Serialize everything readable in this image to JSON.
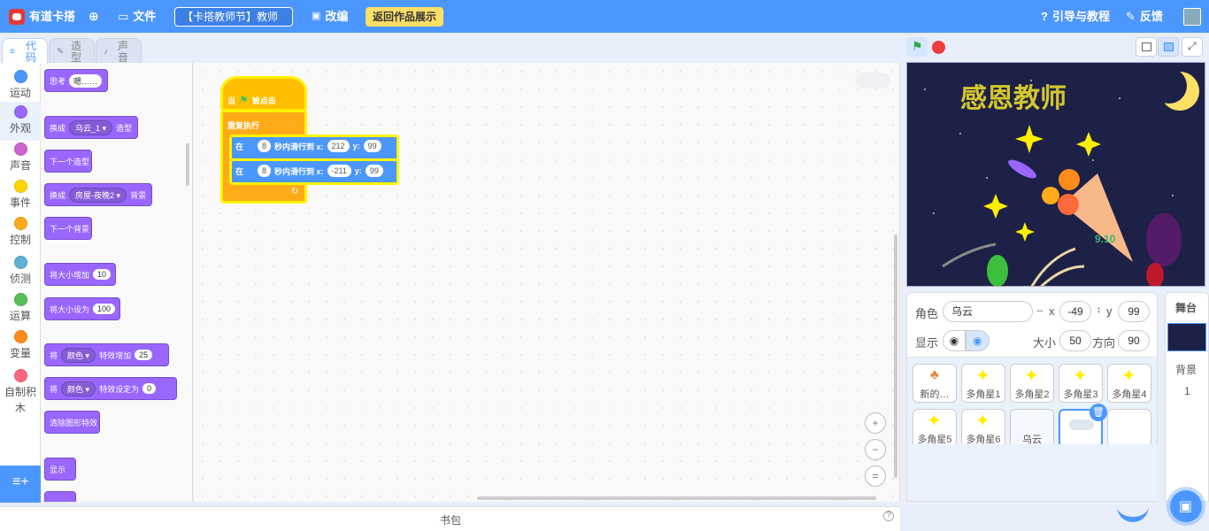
{
  "topbar": {
    "logo_text": "有道卡搭",
    "file_menu": "文件",
    "project_title": "【卡搭教师节】教师",
    "remix": "改编",
    "return_button": "返回作品展示",
    "tutorial": "引导与教程",
    "feedback": "反馈"
  },
  "tabs": {
    "code": "代码",
    "costumes": "造型",
    "sounds": "声音"
  },
  "categories": [
    {
      "label": "运动",
      "color": "#4c97ff"
    },
    {
      "label": "外观",
      "color": "#9966ff"
    },
    {
      "label": "声音",
      "color": "#cf63cf"
    },
    {
      "label": "事件",
      "color": "#ffd500"
    },
    {
      "label": "控制",
      "color": "#ffab19"
    },
    {
      "label": "侦测",
      "color": "#5cb1d6"
    },
    {
      "label": "运算",
      "color": "#59c059"
    },
    {
      "label": "变量",
      "color": "#ff8c1a"
    },
    {
      "label": "自制积木",
      "color": "#ff6680"
    }
  ],
  "palette": {
    "think": "思考",
    "think_value": "嗯……",
    "switch_costume": "换成",
    "costume_name": "乌云_1",
    "costume_suffix": "造型",
    "next_costume": "下一个造型",
    "switch_backdrop": "换成",
    "backdrop_name": "房屋-夜晚2",
    "backdrop_suffix": "背景",
    "next_backdrop": "下一个背景",
    "change_size": "将大小增加",
    "change_size_value": "10",
    "set_size": "将大小设为",
    "set_size_value": "100",
    "effect_prefix": "将",
    "effect_name": "颜色",
    "change_effect": "特效增加",
    "change_effect_value": "25",
    "set_effect": "特效设定为",
    "set_effect_value": "0",
    "clear_effects": "清除图形特效",
    "show": "显示"
  },
  "script": {
    "hat_when": "当",
    "hat_clicked": "被点击",
    "forever": "重复执行",
    "glide1": {
      "in": "在",
      "secs": "8",
      "text": "秒内滑行到 x:",
      "x": "212",
      "y_label": "y:",
      "y": "99"
    },
    "glide2": {
      "in": "在",
      "secs": "8",
      "text": "秒内滑行到 x:",
      "x": "-211",
      "y_label": "y:",
      "y": "99"
    }
  },
  "zoom": {
    "zoom_in": "+",
    "zoom_out": "−",
    "reset": "="
  },
  "backpack": "书包",
  "stage": {
    "title_text": "感恩教师",
    "date_text": "9.10"
  },
  "sprite_info": {
    "sprite_label": "角色",
    "sprite_name": "乌云",
    "x_label": "x",
    "x_value": "-49",
    "y_label": "y",
    "y_value": "99",
    "show_label": "显示",
    "size_label": "大小",
    "size_value": "50",
    "direction_label": "方向",
    "direction_value": "90"
  },
  "sprites": [
    {
      "name": "新的…"
    },
    {
      "name": "多角星1"
    },
    {
      "name": "多角星2"
    },
    {
      "name": "多角星3"
    },
    {
      "name": "多角星4"
    },
    {
      "name": "多角星5"
    },
    {
      "name": "多角星6"
    },
    {
      "name": "乌云"
    },
    {
      "name": ""
    },
    {
      "name": ""
    }
  ],
  "stage_panel": {
    "title": "舞台",
    "backdrop_label": "背景",
    "backdrop_count": "1"
  },
  "colors": {
    "topbar": "#4c97ff",
    "looks": "#9966ff",
    "events": "#ffbf00",
    "control": "#ffab19",
    "motion": "#4c97ff"
  }
}
